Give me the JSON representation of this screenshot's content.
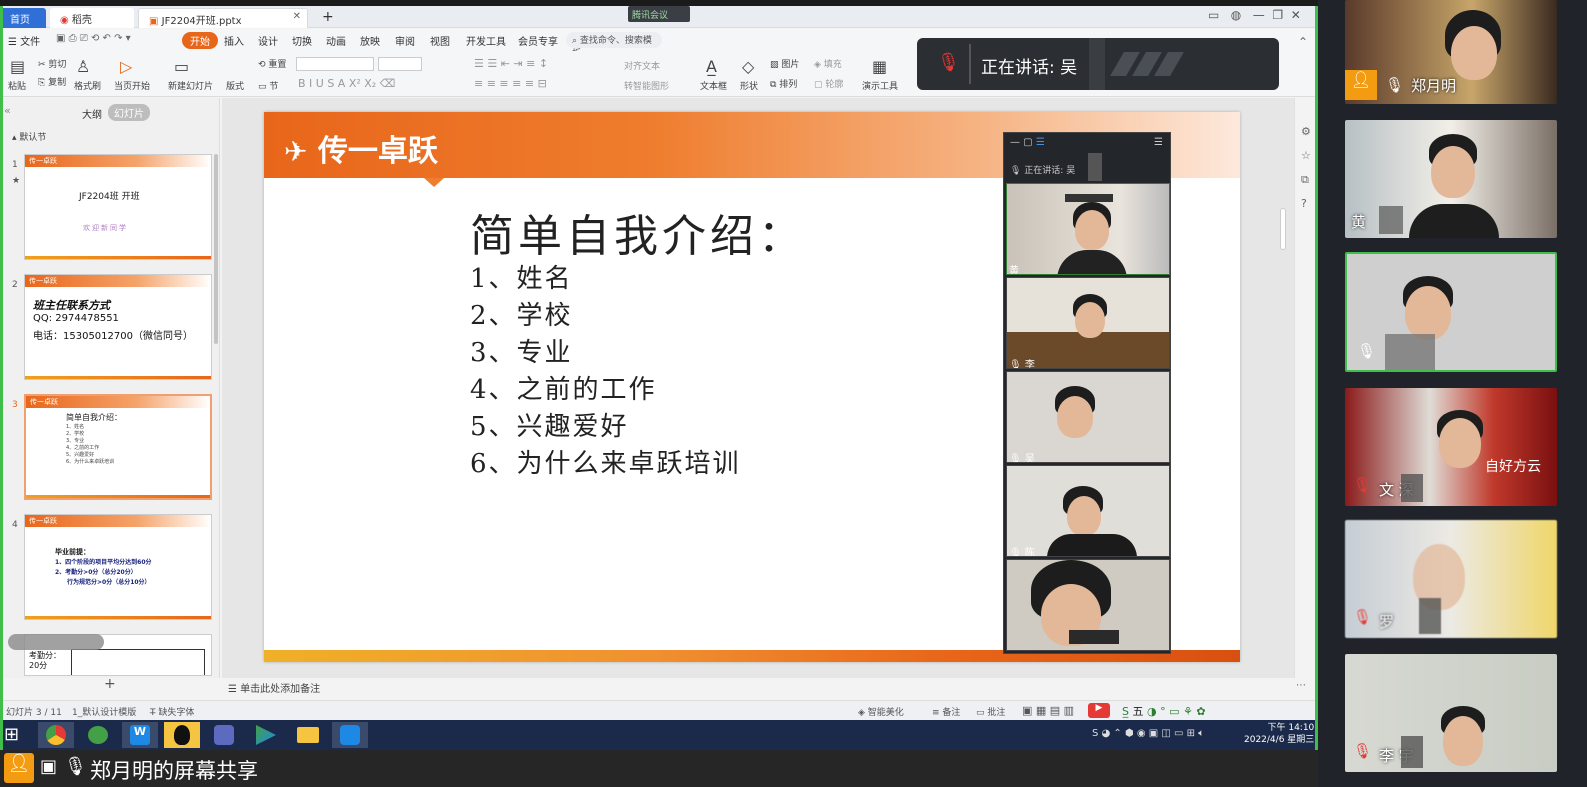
{
  "tabs": {
    "home": "首页",
    "docer": "稻壳",
    "file": "JF2204开班.pptx",
    "meeting": "腾讯会议"
  },
  "ribbon": {
    "file_menu": "文件",
    "tabs": [
      "开始",
      "插入",
      "设计",
      "切换",
      "动画",
      "放映",
      "审阅",
      "视图",
      "开发工具",
      "会员专享"
    ],
    "search_placeholder": "查找命令、搜索模板"
  },
  "toolbar": {
    "cut": "剪切",
    "paste": "粘贴",
    "copy": "复制",
    "format_painter": "格式刷",
    "from_current": "当页开始",
    "new_slide": "新建幻灯片",
    "layout": "版式",
    "section": "节",
    "reset": "重置",
    "text_box": "文本框",
    "shape": "形状",
    "arrange": "排列",
    "picture": "图片",
    "fill": "填充",
    "outline": "轮廓",
    "present_tools": "演示工具",
    "text_direction": "对齐文本",
    "smart_graphic": "转智能图形"
  },
  "left_pane": {
    "outline_tab": "大纲",
    "slides_tab": "幻灯片",
    "section": "默认节",
    "slides": [
      {
        "num": "1",
        "line1": "JF2204班   开班",
        "line2": "欢迎新同学"
      },
      {
        "num": "2",
        "line1": "班主任联系方式",
        "line2": "QQ: 2974478551",
        "line3": "电话：15305012700（微信同号）"
      },
      {
        "num": "3",
        "line1": "简单自我介绍：",
        "lines": [
          "1、姓名",
          "2、学校",
          "3、专业",
          "4、之前的工作",
          "5、兴趣爱好",
          "6、为什么来卓跃培训"
        ]
      },
      {
        "num": "4",
        "line1": "毕业前提：",
        "l2": "1、四个阶段的项目平均分达到60分",
        "l3": "2、考勤分>0分（总分20分）",
        "l4": "行为规范分>0分（总分10分）"
      },
      {
        "num": "5",
        "line1": "考勤分：20分"
      }
    ],
    "add": "+"
  },
  "slide": {
    "logo": "传一卓跃",
    "title": "简单自我介绍：",
    "items": [
      "1、姓名",
      "2、学校",
      "3、专业",
      "4、之前的工作",
      "5、兴趣爱好",
      "6、为什么来卓跃培训"
    ]
  },
  "notes_placeholder": "单击此处添加备注",
  "status": {
    "slide_count": "幻灯片 3 / 11",
    "template": "1_默认设计模版",
    "missing_font": "缺失字体",
    "smart_beautify": "智能美化",
    "notes": "备注",
    "comments": "批注",
    "zoom": "五"
  },
  "clock": {
    "time": "下午 14:10",
    "date": "2022/4/6 星期三"
  },
  "speaker": {
    "label": "正在讲话: 吴",
    "suffix": ""
  },
  "mini_gallery": {
    "speaking": "正在讲话: 吴",
    "names": [
      "黄",
      "李",
      "吴",
      "陈",
      ""
    ]
  },
  "share_bar": {
    "text": "郑月明的屏幕共享"
  },
  "participants": [
    {
      "name": "郑月明",
      "mic": "on"
    },
    {
      "name": "黄",
      "mic": "none"
    },
    {
      "name": "",
      "mic": "on"
    },
    {
      "name": "文    深",
      "mic": "muted"
    },
    {
      "name": "罗",
      "mic": "muted"
    },
    {
      "name": "李    宇",
      "mic": "muted"
    }
  ],
  "colors": {
    "accent": "#e8661a",
    "active_green": "#3fbf4a",
    "muted_red": "#e53935"
  }
}
